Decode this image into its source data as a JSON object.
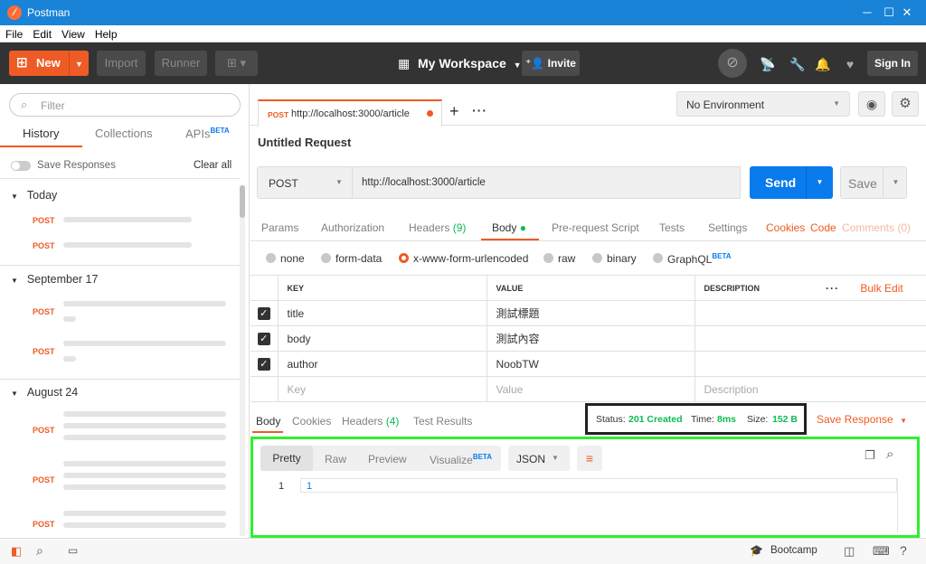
{
  "window": {
    "title": "Postman",
    "logo": "postman-logo-icon"
  },
  "menu": [
    "File",
    "Edit",
    "View",
    "Help"
  ],
  "header": {
    "new_label": "New",
    "import_label": "Import",
    "runner_label": "Runner",
    "workspace_label": "My Workspace",
    "invite_label": "Invite",
    "signin_label": "Sign In",
    "accent": "#ef5b25"
  },
  "sidebar": {
    "filter_placeholder": "Filter",
    "tabs": [
      "History",
      "Collections",
      "APIs"
    ],
    "apis_badge": "BETA",
    "save_responses_label": "Save Responses",
    "clear_all_label": "Clear all",
    "groups": [
      {
        "label": "Today",
        "items": [
          "POST",
          "POST"
        ]
      },
      {
        "label": "September 17",
        "items": [
          "POST",
          "POST"
        ]
      },
      {
        "label": "August 24",
        "items": [
          "POST",
          "POST",
          "POST",
          "POST"
        ]
      }
    ]
  },
  "request": {
    "tab_method": "POST",
    "tab_url": "http://localhost:3000/article",
    "title": "Untitled Request",
    "method": "POST",
    "url": "http://localhost:3000/article",
    "send_label": "Send",
    "save_label": "Save",
    "environment": "No Environment",
    "subtabs": {
      "params": "Params",
      "authorization": "Authorization",
      "headers": "Headers",
      "headers_count": "(9)",
      "body": "Body",
      "prerequest": "Pre-request Script",
      "tests": "Tests",
      "settings": "Settings",
      "cookies": "Cookies",
      "code": "Code",
      "comments": "Comments (0)"
    },
    "body_types": [
      "none",
      "form-data",
      "x-www-form-urlencoded",
      "raw",
      "binary",
      "GraphQL"
    ],
    "graphql_badge": "BETA",
    "table": {
      "headers": [
        "KEY",
        "VALUE",
        "DESCRIPTION"
      ],
      "bulk_edit": "Bulk Edit",
      "rows": [
        {
          "key": "title",
          "value": "測試標題"
        },
        {
          "key": "body",
          "value": "測試內容"
        },
        {
          "key": "author",
          "value": "NoobTW"
        }
      ],
      "placeholder": {
        "key": "Key",
        "value": "Value",
        "description": "Description"
      }
    }
  },
  "response": {
    "tabs": {
      "body": "Body",
      "cookies": "Cookies",
      "headers": "Headers",
      "headers_count": "(4)",
      "tests": "Test Results"
    },
    "status_label": "Status:",
    "status": "201 Created",
    "time_label": "Time:",
    "time": "8ms",
    "size_label": "Size:",
    "size": "152 B",
    "save_response": "Save Response",
    "view_tabs": [
      "Pretty",
      "Raw",
      "Preview",
      "Visualize"
    ],
    "visualize_badge": "BETA",
    "format": "JSON",
    "line_number": "1",
    "line_content": "1"
  },
  "footer": {
    "bootcamp_label": "Bootcamp"
  }
}
